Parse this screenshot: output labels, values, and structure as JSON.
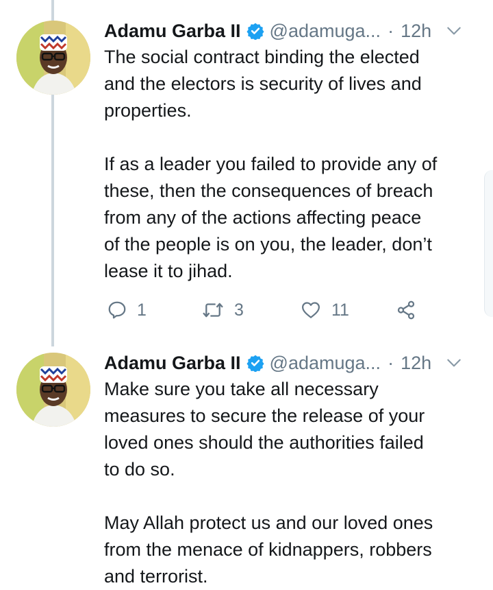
{
  "tweets": [
    {
      "author_name": "Adamu Garba II",
      "handle": "@adamuga...",
      "separator": "·",
      "time": "12h",
      "text": "The social contract binding the elected\nand the electors is security of lives and\nproperties.\n\nIf as a leader you failed to provide any of\nthese, then the consequences of breach\nfrom any of the actions affecting peace\nof the people is on you, the leader, don’t\nlease it to jihad.",
      "reply_count": "1",
      "retweet_count": "3",
      "like_count": "11"
    },
    {
      "author_name": "Adamu Garba II",
      "handle": "@adamuga...",
      "separator": "·",
      "time": "12h",
      "text": "Make sure you take all necessary\nmeasures to secure the release of your\nloved ones should the authorities failed\nto do so.\n\nMay Allah protect us and our loved ones\nfrom the menace of kidnappers, robbers\nand terrorist."
    }
  ],
  "colors": {
    "text": "#14171a",
    "secondary": "#657786",
    "verified": "#1da1f2",
    "thread_line": "#ccd6dd"
  },
  "icons": [
    "verified-badge-icon",
    "chevron-down-icon",
    "reply-icon",
    "retweet-icon",
    "like-icon",
    "share-icon"
  ]
}
